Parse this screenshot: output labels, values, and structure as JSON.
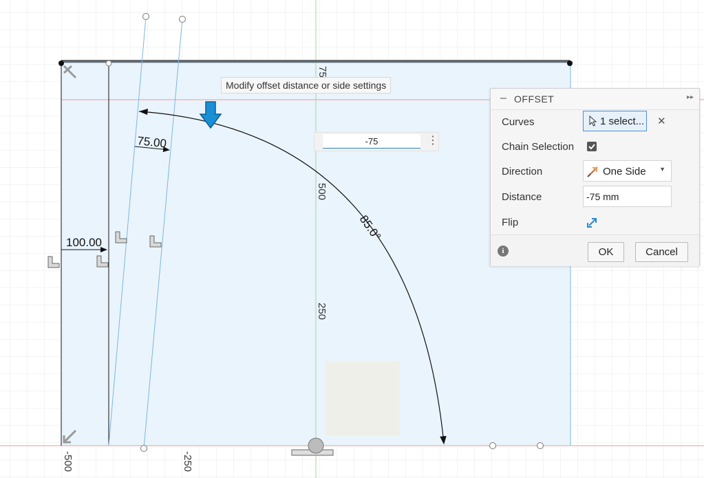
{
  "canvas": {
    "tooltip": "Modify offset distance or side settings",
    "dim_input_value": "-75",
    "dimension_labels": {
      "d100": "100.00",
      "d75": "75.00",
      "angle": "85.0°"
    },
    "ruler_labels": {
      "v75": "75",
      "v500": "500",
      "v250": "250",
      "h_neg500": "-500",
      "h_neg250": "-250"
    },
    "colors": {
      "sketch_fill": "#eaf4fc",
      "grid": "#e6e6e6",
      "construction_line": "#7ab8e0",
      "axis_green": "#8fd18f",
      "axis_red": "#ee8888",
      "arrow_blue": "#1a8fd6"
    }
  },
  "offset_panel": {
    "title": "OFFSET",
    "curves_label": "Curves",
    "curves_value": "1 select...",
    "chain_selection_label": "Chain Selection",
    "chain_selection_checked": true,
    "direction_label": "Direction",
    "direction_value": "One Side",
    "distance_label": "Distance",
    "distance_value": "-75 mm",
    "flip_label": "Flip",
    "ok_label": "OK",
    "cancel_label": "Cancel",
    "icons": [
      "collapse-icon",
      "expand-panel-icon",
      "cursor-icon",
      "clear-icon",
      "check-icon",
      "direction-icon",
      "caret-down-icon",
      "flip-icon",
      "info-icon"
    ]
  }
}
